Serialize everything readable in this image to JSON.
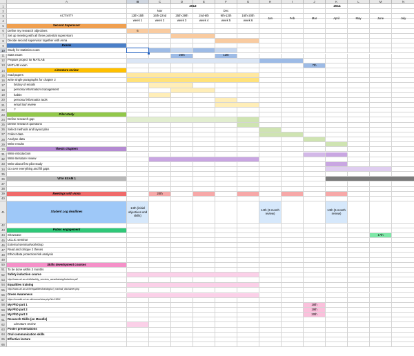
{
  "col_letters": [
    "A",
    "B",
    "C",
    "D",
    "E",
    "F",
    "G",
    "H",
    "I",
    "J",
    "K",
    "L",
    "M",
    "N"
  ],
  "header": {
    "year_2013": "2013",
    "year_2014": "2014",
    "activity_label": "ACTIVITY",
    "months_2013": [
      "Nov",
      "Dec"
    ],
    "date_ranges": [
      "13th-15th",
      "16th-22nd",
      "25th-29th",
      "2nd-6th",
      "9th-13th",
      "16th-20th"
    ],
    "week_labels": [
      "week 1",
      "week 2",
      "week 3",
      "week 4",
      "week 5",
      "week 6"
    ],
    "months_2014": [
      "Jan",
      "Feb",
      "Mar",
      "April",
      "May",
      "June",
      "July"
    ]
  },
  "rows": [
    {
      "n": 1,
      "label": ""
    },
    {
      "n": 2,
      "label": ""
    },
    {
      "n": 3,
      "label": ""
    },
    {
      "n": 4,
      "label": ""
    },
    {
      "n": 5,
      "label": "Second Supervisor",
      "section": "#f0a050"
    },
    {
      "n": 6,
      "label": "Define my research objectives"
    },
    {
      "n": 7,
      "label": "Set up meeting with all three potential supervisors"
    },
    {
      "n": 8,
      "label": "Decide second supervisor together with Anna"
    },
    {
      "n": 9,
      "label": "Exams",
      "section": "#4a7fc8"
    },
    {
      "n": 10,
      "label": "Study for statistics exam"
    },
    {
      "n": 11,
      "label": "Stats exam"
    },
    {
      "n": 12,
      "label": "Prepare project for MATLAB"
    },
    {
      "n": 13,
      "label": "MATLAB exam"
    },
    {
      "n": 14,
      "label": "Literature review",
      "section": "#ffc000"
    },
    {
      "n": 15,
      "label": "read papers"
    },
    {
      "n": 16,
      "label": "write single paragraphs for chapter 2"
    },
    {
      "n": 17,
      "label": "history of emails",
      "sub": true
    },
    {
      "n": 18,
      "label": "personal information management",
      "sub": true
    },
    {
      "n": 19,
      "label": "habits",
      "sub": true
    },
    {
      "n": 20,
      "label": "personal informatics tools",
      "sub": true
    },
    {
      "n": 21,
      "label": "email tool review",
      "sub": true
    },
    {
      "n": 22,
      "label": "?",
      "sub": true
    },
    {
      "n": 23,
      "label": "Pilot study",
      "section": "#92c84a"
    },
    {
      "n": 24,
      "label": "Define research gap"
    },
    {
      "n": 25,
      "label": "Define research questions"
    },
    {
      "n": 26,
      "label": "Select methods and layout plan"
    },
    {
      "n": 27,
      "label": "Collect data"
    },
    {
      "n": 28,
      "label": "Analyse data"
    },
    {
      "n": 29,
      "label": "Write results"
    },
    {
      "n": 30,
      "label": "Thesis chapters",
      "section": "#b48ad2"
    },
    {
      "n": 31,
      "label": "Write introduction"
    },
    {
      "n": 32,
      "label": "Write literature review"
    },
    {
      "n": 33,
      "label": "Write about first pilot study"
    },
    {
      "n": 34,
      "label": "Go over everything and fill gaps"
    },
    {
      "n": 35,
      "label": ""
    },
    {
      "n": 36,
      "label": "VIVA EXAM 1",
      "center": true,
      "fill": "#b8b8b8"
    },
    {
      "n": 37,
      "label": ""
    },
    {
      "n": 38,
      "label": ""
    },
    {
      "n": 39,
      "label": "Meetings with Anna",
      "section": "#f06a6a"
    },
    {
      "n": 40,
      "label": ""
    },
    {
      "n": 41,
      "label": "Student Log deadlines",
      "section": "#9ec8f8",
      "tall": true
    },
    {
      "n": 42,
      "label": ""
    },
    {
      "n": 43,
      "label": "Public engagement",
      "section": "#2fc878"
    },
    {
      "n": 44,
      "label": "Showcase"
    },
    {
      "n": 45,
      "label": "UCLIC seminar"
    },
    {
      "n": 46,
      "label": "External seminar/workshop"
    },
    {
      "n": 47,
      "label": "Read and critique 2 theses"
    },
    {
      "n": 48,
      "label": "Ethics/data protection/risk analysis"
    },
    {
      "n": 49,
      "label": ""
    },
    {
      "n": 50,
      "label": "Skills development courses",
      "section": "#f590c8"
    },
    {
      "n": 51,
      "label": "To be done within 3 months"
    },
    {
      "n": 52,
      "label": "Safety induction course",
      "bold": true
    },
    {
      "n": 53,
      "label": "http://www.ucl.ac.uk/efd/safety_services_www/training/induction.pdf",
      "url": true,
      "tall": true
    },
    {
      "n": 54,
      "label": "Equalities training",
      "bold": true
    },
    {
      "n": 55,
      "label": "http://www.ucl.ac.uk/hr/equalities/training/ucl_manhall_disclaimer.php",
      "url": true,
      "tall": true
    },
    {
      "n": 56,
      "label": "Green Awareness",
      "bold": true
    },
    {
      "n": 57,
      "label": "https://moodle.ucl.ac.uk/course/view.php?id=21801",
      "url": true
    },
    {
      "n": 58,
      "label": "My PhD part 1",
      "bold": true
    },
    {
      "n": 59,
      "label": "My PhD part 2",
      "bold": true
    },
    {
      "n": 60,
      "label": "My PhD part 3",
      "bold": true
    },
    {
      "n": 61,
      "label": "Research Skills (on Moodle)",
      "bold": true
    },
    {
      "n": 62,
      "label": "Literature review",
      "sub": true
    },
    {
      "n": 63,
      "label": "Poster presentations",
      "bold": true
    },
    {
      "n": 64,
      "label": "Oral communication skills",
      "bold": true
    },
    {
      "n": 65,
      "label": "Effective lecture",
      "bold": true
    },
    {
      "n": 66,
      "label": ""
    }
  ],
  "bars": [
    {
      "row": 6,
      "c1": 1,
      "c2": 1,
      "color": "#f9cba0",
      "text": "6"
    },
    {
      "row": 6,
      "c1": 2,
      "c2": 2,
      "color": "#f9cba0"
    },
    {
      "row": 7,
      "c1": 3,
      "c2": 4,
      "color": "#f9cba0"
    },
    {
      "row": 8,
      "c1": 5,
      "c2": 6,
      "color": "#f9cba0"
    },
    {
      "row": 10,
      "c1": 2,
      "c2": 2,
      "color": "#9dbbe6"
    },
    {
      "row": 10,
      "c1": 3,
      "c2": 3,
      "color": "#c5d7f0"
    },
    {
      "row": 10,
      "c1": 4,
      "c2": 4,
      "color": "#9dbbe6"
    },
    {
      "row": 10,
      "c1": 5,
      "c2": 5,
      "color": "#c5d7f0"
    },
    {
      "row": 11,
      "c1": 3,
      "c2": 3,
      "color": "#9dbbe6",
      "text": "26th"
    },
    {
      "row": 11,
      "c1": 5,
      "c2": 5,
      "color": "#9dbbe6",
      "text": "12th"
    },
    {
      "row": 12,
      "c1": 1,
      "c2": 7,
      "color": "#dbe6f5"
    },
    {
      "row": 12,
      "c1": 7,
      "c2": 8,
      "color": "#9dbbe6"
    },
    {
      "row": 13,
      "c1": 9,
      "c2": 9,
      "color": "#9dbbe6",
      "text": "7th"
    },
    {
      "row": 15,
      "c1": 1,
      "c2": 6,
      "color": "#ffe8a0"
    },
    {
      "row": 16,
      "c1": 1,
      "c2": 6,
      "color": "#ffe27a"
    },
    {
      "row": 17,
      "c1": 2,
      "c2": 3,
      "color": "#ffeeb8"
    },
    {
      "row": 18,
      "c1": 3,
      "c2": 4,
      "color": "#ffeeb8"
    },
    {
      "row": 19,
      "c1": 2,
      "c2": 2,
      "color": "#ffeeb8"
    },
    {
      "row": 20,
      "c1": 5,
      "c2": 5,
      "color": "#ffeeb8"
    },
    {
      "row": 21,
      "c1": 5,
      "c2": 6,
      "color": "#ffeeb8"
    },
    {
      "row": 24,
      "c1": 1,
      "c2": 5,
      "color": "#e2eed0"
    },
    {
      "row": 24,
      "c1": 6,
      "c2": 6,
      "color": "#cfe4b2"
    },
    {
      "row": 25,
      "c1": 6,
      "c2": 6,
      "color": "#cfe4b2"
    },
    {
      "row": 26,
      "c1": 7,
      "c2": 7,
      "color": "#cfe4b2"
    },
    {
      "row": 27,
      "c1": 7,
      "c2": 8,
      "color": "#cfe4b2"
    },
    {
      "row": 28,
      "c1": 9,
      "c2": 9,
      "color": "#cfe4b2"
    },
    {
      "row": 29,
      "c1": 10,
      "c2": 10,
      "color": "#cfe4b2"
    },
    {
      "row": 31,
      "c1": 9,
      "c2": 9,
      "color": "#d3b8e8"
    },
    {
      "row": 31,
      "c1": 10,
      "c2": 10,
      "color": "#c9a6e2"
    },
    {
      "row": 32,
      "c1": 2,
      "c2": 6,
      "color": "#c9a6e2"
    },
    {
      "row": 33,
      "c1": 10,
      "c2": 10,
      "color": "#c9a6e2"
    },
    {
      "row": 34,
      "c1": 10,
      "c2": 12,
      "color": "#dfcdf0"
    },
    {
      "row": 36,
      "c1": 10,
      "c2": 13,
      "color": "#7a7a7a"
    },
    {
      "row": 39,
      "c1": 2,
      "c2": 2,
      "color": "#f7a8a8",
      "text": "20th"
    },
    {
      "row": 39,
      "c1": 4,
      "c2": 4,
      "color": "#f7a8a8"
    },
    {
      "row": 39,
      "c1": 6,
      "c2": 6,
      "color": "#f7a8a8"
    },
    {
      "row": 39,
      "c1": 8,
      "c2": 8,
      "color": "#f7a8a8"
    },
    {
      "row": 39,
      "c1": 10,
      "c2": 10,
      "color": "#f7a8a8"
    },
    {
      "row": 41,
      "c1": 1,
      "c2": 1,
      "color": "#d6e8fb",
      "text": "14th (initial objectives and skills)",
      "wrap": true
    },
    {
      "row": 41,
      "c1": 7,
      "c2": 7,
      "color": "#d6e8fb",
      "text": "14th (3-month review)",
      "wrap": true
    },
    {
      "row": 41,
      "c1": 10,
      "c2": 10,
      "color": "#d6e8fb",
      "text": "14th (6-month review)",
      "wrap": true
    },
    {
      "row": 44,
      "c1": 12,
      "c2": 12,
      "color": "#7ee8a8",
      "text": "17th"
    },
    {
      "row": 52,
      "c1": 1,
      "c2": 6,
      "color": "#fbd0e8"
    },
    {
      "row": 54,
      "c1": 1,
      "c2": 6,
      "color": "#fbd0e8"
    },
    {
      "row": 56,
      "c1": 1,
      "c2": 6,
      "color": "#fbd0e8"
    },
    {
      "row": 58,
      "c1": 9,
      "c2": 9,
      "color": "#fbc0dc",
      "text": "18th"
    },
    {
      "row": 59,
      "c1": 9,
      "c2": 9,
      "color": "#fbc0dc",
      "text": "19th"
    },
    {
      "row": 60,
      "c1": 9,
      "c2": 9,
      "color": "#fbc0dc",
      "text": "20th"
    },
    {
      "row": 62,
      "c1": 1,
      "c2": 1,
      "color": "#fbd0e8"
    }
  ]
}
